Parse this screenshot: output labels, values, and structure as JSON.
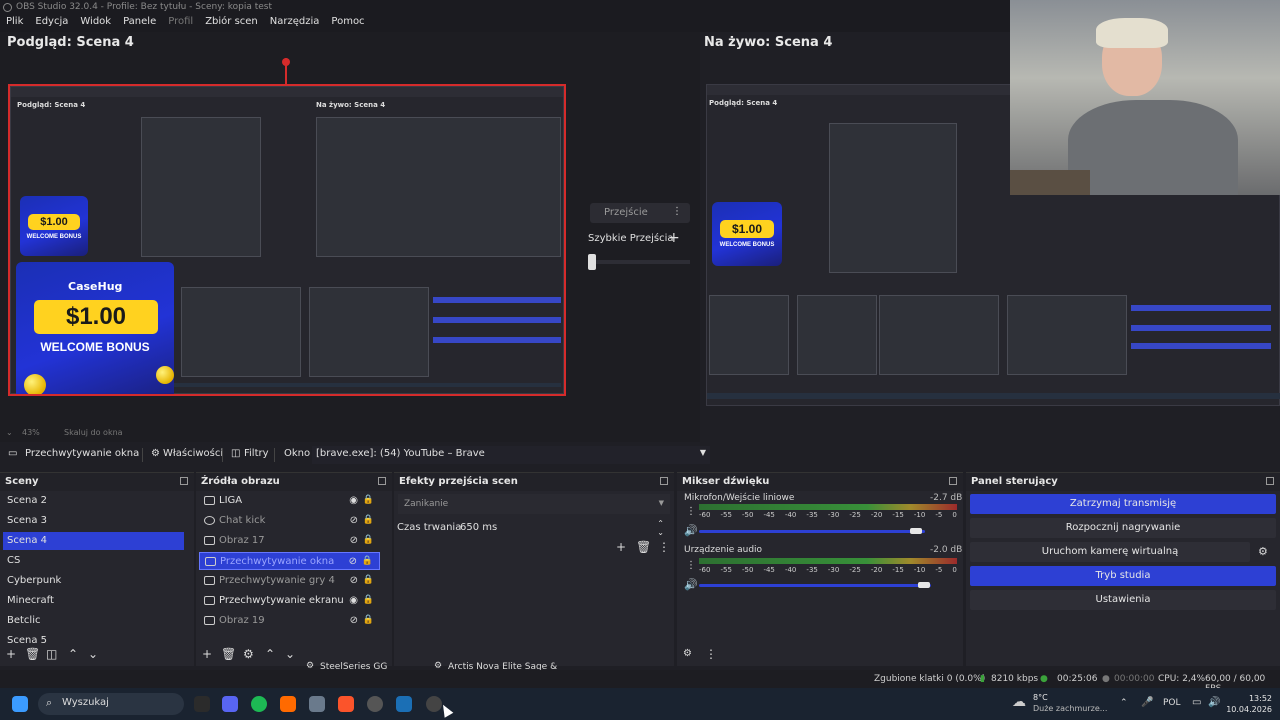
{
  "window": {
    "title": "OBS Studio 32.0.4 - Profile: Bez tytułu - Sceny: kopia test"
  },
  "menu": {
    "items": [
      "Plik",
      "Edycja",
      "Widok",
      "Panele",
      "Profil",
      "Zbiór scen",
      "Narzędzia",
      "Pomoc"
    ]
  },
  "preview": {
    "title": "Podgląd: Scena 4"
  },
  "program": {
    "title": "Na żywo: Scena 4"
  },
  "promo": {
    "brand": "CaseHug",
    "amount": "$1.00",
    "bonus": "WELCOME BONUS"
  },
  "transition": {
    "dropdown": "Przejście",
    "quick_label": "Szybkie Przejścia",
    "add": "+"
  },
  "zoom": {
    "value": "43%",
    "mode": "Skaluj do okna"
  },
  "source_toolbar": {
    "source_name": "Przechwytywanie okna",
    "properties": "Właściwości",
    "filters": "Filtry",
    "window_label": "Okno",
    "window_value": "[brave.exe]: (54) YouTube – Brave"
  },
  "scenes": {
    "title": "Sceny",
    "items": [
      "Scena 2",
      "Scena 3",
      "Scena 4",
      "CS",
      "Cyberpunk",
      "Minecraft",
      "Betclic",
      "Scena 5"
    ],
    "selected_index": 2
  },
  "sources": {
    "title": "Źródła obrazu",
    "items": [
      "LIGA",
      "Chat kick",
      "Obraz 17",
      "Przechwytywanie okna",
      "Przechwytywanie gry 4",
      "Przechwytywanie ekranu",
      "Obraz 19"
    ],
    "selected_index": 3
  },
  "transitions_dock": {
    "title": "Efekty przejścia scen",
    "type": "Zanikanie",
    "duration_label": "Czas trwania",
    "duration_value": "650 ms"
  },
  "mixer": {
    "title": "Mikser dźwięku",
    "channels": [
      {
        "name": "Mikrofon/Wejście liniowe",
        "db": "-2.7 dB",
        "volume": 0.93
      },
      {
        "name": "Urządzenie audio",
        "db": "-2.0 dB",
        "volume": 0.97
      }
    ],
    "scale": [
      "-60",
      "-55",
      "-50",
      "-45",
      "-40",
      "-35",
      "-30",
      "-25",
      "-20",
      "-15",
      "-10",
      "-5",
      "0"
    ]
  },
  "controls": {
    "title": "Panel sterujący",
    "buttons": [
      "Zatrzymaj transmisję",
      "Rozpocznij nagrywanie",
      "Uruchom kamerę wirtualną",
      "Tryb studia",
      "Ustawienia"
    ]
  },
  "status": {
    "dropped": "Zgubione klatki 0 (0.0%)",
    "bitrate": "8210 kbps",
    "stream_time": "00:25:06",
    "rec_time": "00:00:00",
    "cpu": "CPU: 2,4%",
    "fps": "60,00 / 60,00 FPS"
  },
  "overlay_popups": {
    "left": "SteelSeries GG",
    "right": "Arctis Nova Elite Sage & G..."
  },
  "taskbar": {
    "search": "Wyszukaj",
    "weather_temp": "8°C",
    "weather_desc": "Duże zachmurze...",
    "lang": "POL",
    "time": "13:52",
    "date": "10.04.2026"
  },
  "colors": {
    "accent": "#2d40d4",
    "preview_border": "#d52b2b",
    "promo_blue": "#1b2fb5",
    "promo_yellow": "#ffd21f"
  }
}
